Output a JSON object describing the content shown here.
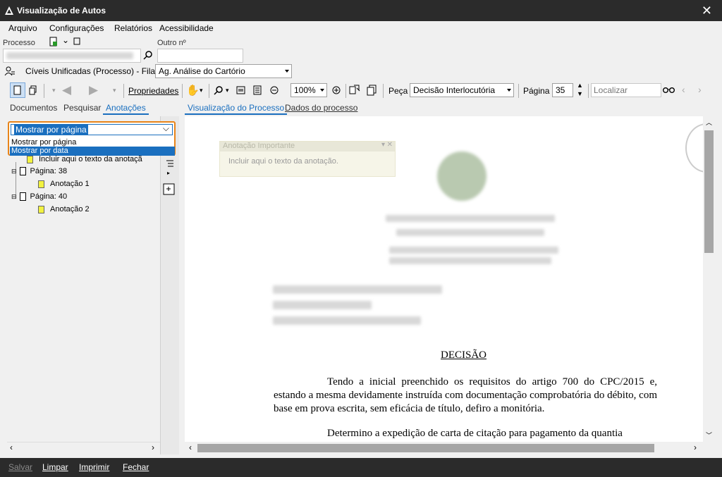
{
  "window": {
    "title": "Visualização de Autos",
    "close_icon": "close-icon"
  },
  "menu": [
    "Arquivo",
    "Configurações",
    "Relatórios",
    "Acessibilidade"
  ],
  "search": {
    "processo_label": "Processo",
    "outro_label": "Outro nº",
    "outro_value": ""
  },
  "queue": {
    "text": "Cíveis Unificadas (Processo) - Fila:",
    "selected": "Ag. Análise do Cartório"
  },
  "toolbar": {
    "propriedades": "Propriedades",
    "zoom": "100%",
    "peca_label": "Peça",
    "peca_value": "Decisão Interlocutória",
    "pagina_label": "Página",
    "pagina_value": "35",
    "localizar_placeholder": "Localizar"
  },
  "left_tabs": [
    "Documentos",
    "Pesquisar",
    "Anotações"
  ],
  "right_tabs": [
    "Visualização do Processo",
    "Dados do processo"
  ],
  "dropdown": {
    "selected": "Mostrar por página",
    "options": [
      "Mostrar por página",
      "Mostrar por data"
    ]
  },
  "tree": {
    "partial_text": "Incluir aqui o texto da anotaçã",
    "items": [
      {
        "page": "Página: 38",
        "note": "Anotação 1"
      },
      {
        "page": "Página: 40",
        "note": "Anotação 2"
      }
    ]
  },
  "annotation_popup": {
    "title": "Anotação Importante",
    "placeholder": "Incluir aqui o texto da anotação."
  },
  "document": {
    "heading": "DECISÃO",
    "paragraph1": "Tendo a inicial preenchido os requisitos do artigo 700 do CPC/2015 e, estando a mesma devidamente instruída com documentação comprobatória do débito, com base em prova escrita, sem eficácia de título, defiro a monitória.",
    "paragraph2": "Determino a expedição de carta de citação para pagamento da quantia"
  },
  "statusbar": [
    "Salvar",
    "Limpar",
    "Imprimir",
    "Fechar"
  ]
}
